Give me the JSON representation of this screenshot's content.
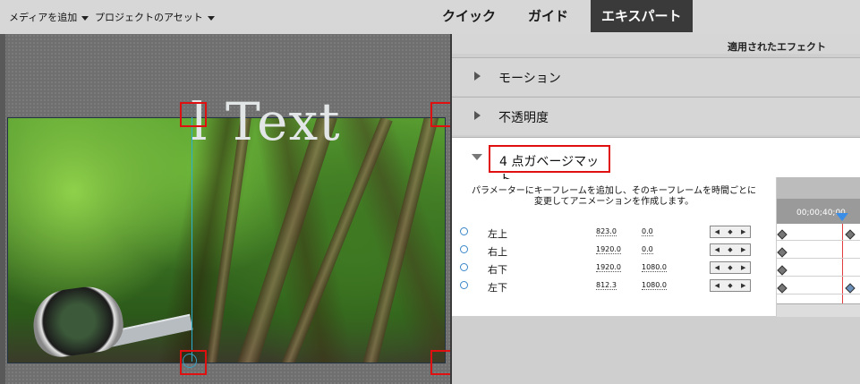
{
  "menus": {
    "add_media": "メディアを追加",
    "project_assets": "プロジェクトのアセット"
  },
  "modes": {
    "quick": "クイック",
    "guided": "ガイド",
    "expert": "エキスパート"
  },
  "monitor": {
    "overlay_text": "l Text"
  },
  "panel": {
    "title": "適用されたエフェクト",
    "effects": [
      {
        "label": "モーション"
      },
      {
        "label": "不透明度"
      },
      {
        "label": "4 点ガベージマット"
      }
    ],
    "description_line1": "パラメーターにキーフレームを追加し、そのキーフレームを時間ごとに",
    "description_line2": "変更してアニメーションを作成します。",
    "params": [
      {
        "name": "左上",
        "x": "823.0",
        "y": "0.0"
      },
      {
        "name": "右上",
        "x": "1920.0",
        "y": "0.0"
      },
      {
        "name": "右下",
        "x": "1920.0",
        "y": "1080.0"
      },
      {
        "name": "左下",
        "x": "812.3",
        "y": "1080.0"
      }
    ],
    "timecode": "00;00;40;00"
  },
  "colors": {
    "highlight": "#e01010",
    "active_mode_bg": "#3a3a3a"
  }
}
